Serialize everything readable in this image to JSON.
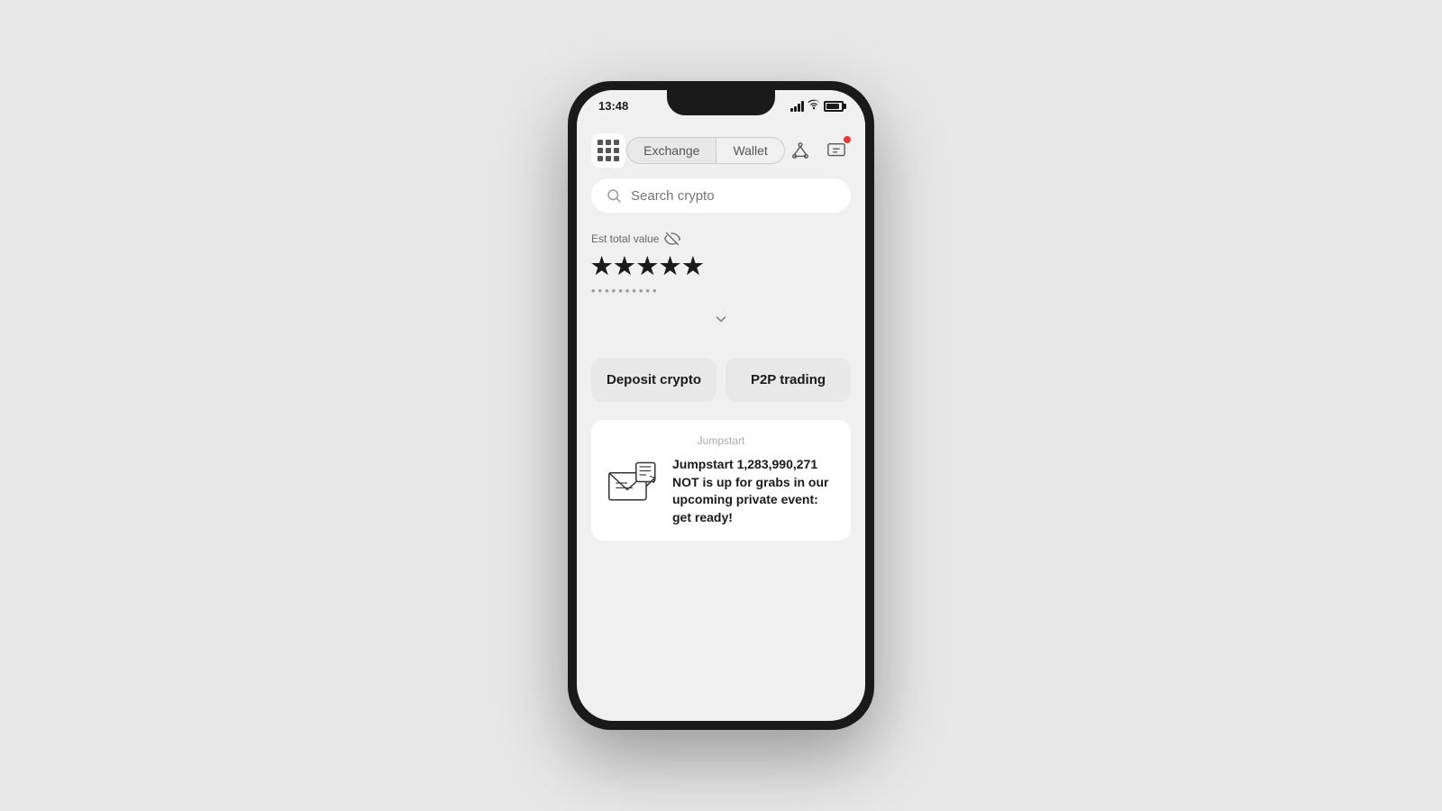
{
  "status_bar": {
    "time": "13:48"
  },
  "nav": {
    "exchange_label": "Exchange",
    "wallet_label": "Wallet"
  },
  "search": {
    "placeholder": "Search crypto"
  },
  "portfolio": {
    "est_label": "Est total value",
    "total_stars": "★★★★★",
    "secondary_dots": "••••••••••"
  },
  "buttons": {
    "deposit": "Deposit crypto",
    "p2p": "P2P trading"
  },
  "jumpstart": {
    "section_label": "Jumpstart",
    "text": "Jumpstart 1,283,990,271 NOT is up for grabs in our upcoming private event: get ready!"
  }
}
